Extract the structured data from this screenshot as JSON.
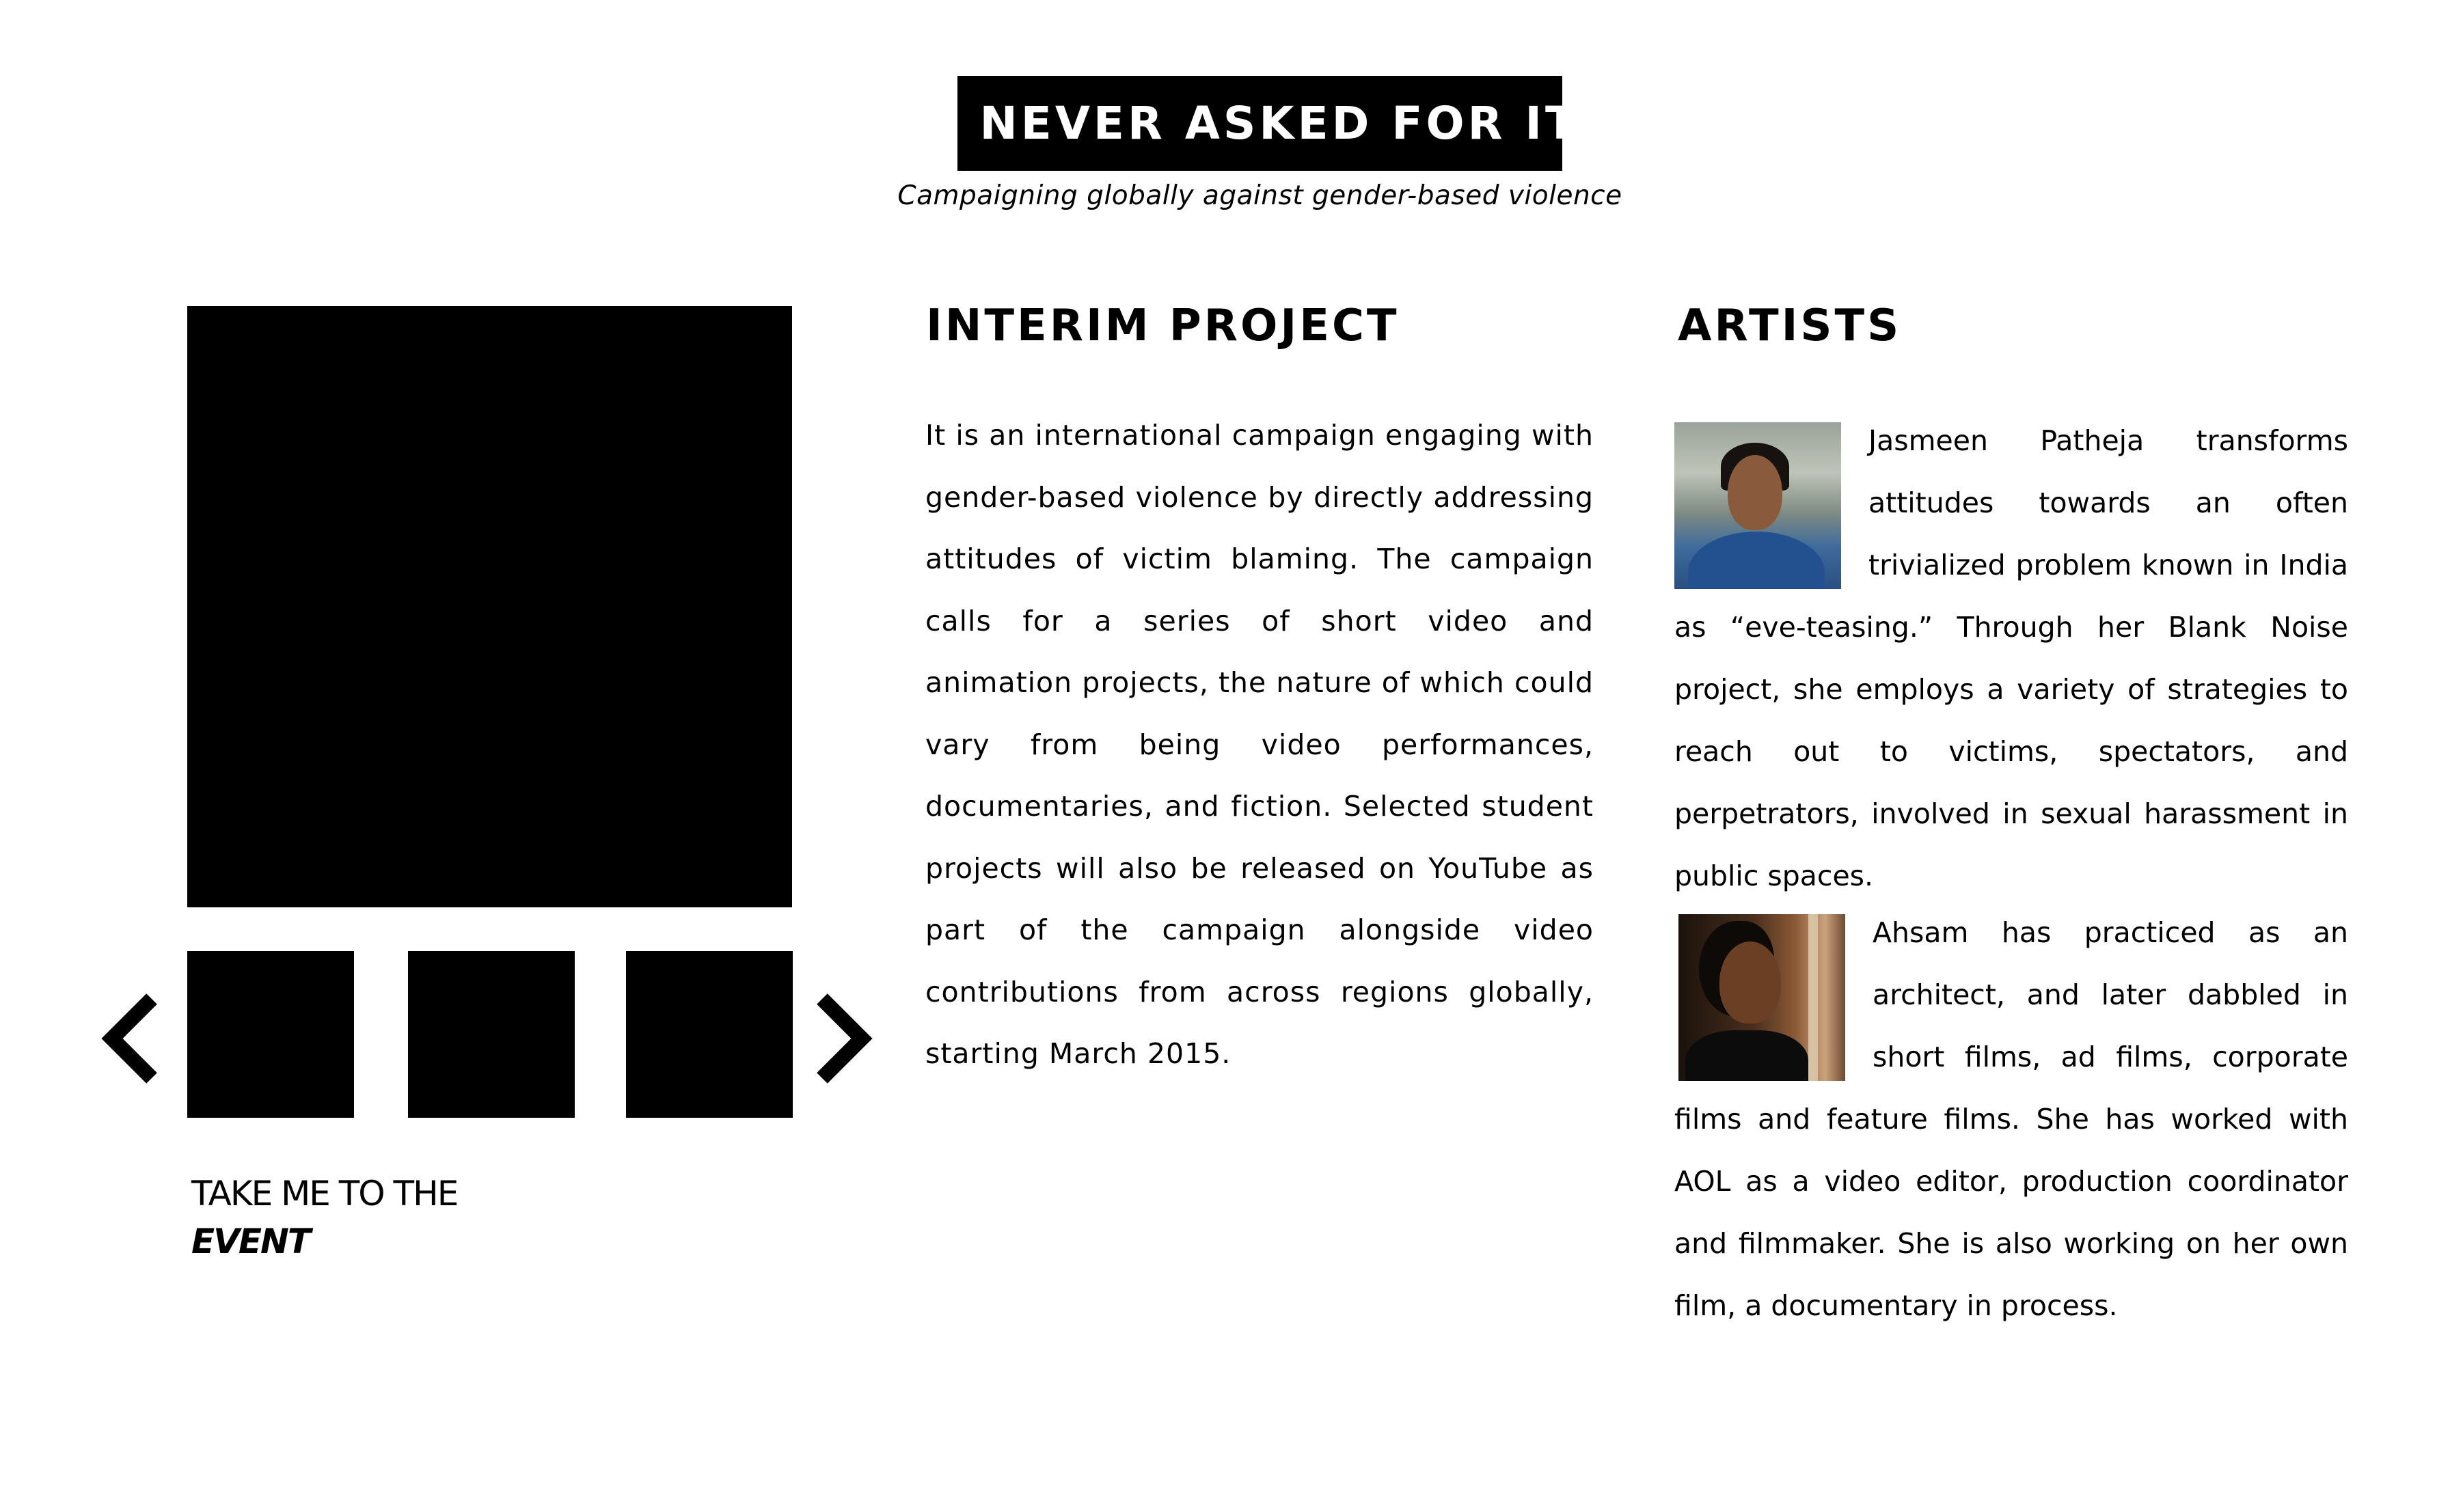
{
  "header": {
    "logo_text": "I NEVER ASKED FOR IT",
    "tagline": "Campaigning globally against gender-based violence"
  },
  "gallery": {
    "prev_icon": "chevron-left-icon",
    "next_icon": "chevron-right-icon",
    "thumbnail_count": 3
  },
  "event_link": {
    "line1": "TAKE ME TO THE",
    "line2": "EVENT"
  },
  "interim": {
    "heading": "INTERIM PROJECT",
    "body": "It is an international campaign engaging with gender-based violence by directly addressing attitudes of victim blaming. The campaign calls for a series of short video and animation projects, the nature of which could vary from being video performances, documentaries, and fiction. Selected student projects will also be released on YouTube as part of the campaign alongside video contributions from across regions globally, starting March 2015."
  },
  "artists": {
    "heading": "ARTISTS",
    "items": [
      {
        "text": "Jasmeen Patheja transforms attitudes towards an often  trivialized problem known in India as “eve-teasing.” Through her Blank Noise project, she employs a variety of strategies to reach out to victims, spectators, and perpetrators, involved in sexual harassment in public spaces."
      },
      {
        "text": "Ahsam has practiced as an architect, and later dabbled in short films, ad films, corporate films and feature films. She has worked with AOL as a video editor, production coordinator and filmmaker. She is also working on her own film, a documentary in process."
      }
    ]
  },
  "colors": {
    "background": "#ffffff",
    "ink": "#000000"
  }
}
